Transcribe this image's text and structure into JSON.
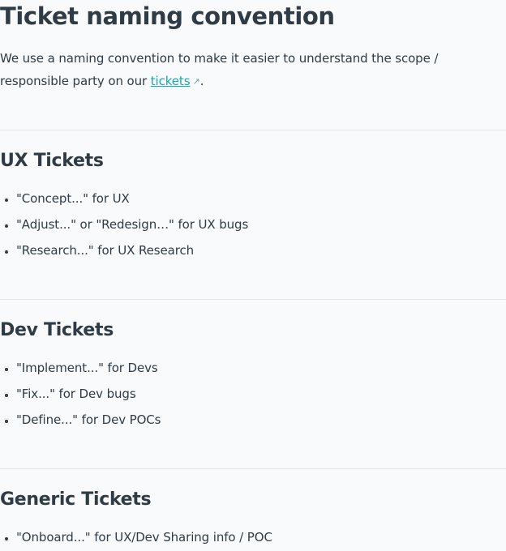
{
  "page": {
    "title": "Ticket naming convention",
    "intro_text": "We use a naming convention to make it easier to understand the scope / responsible party on our",
    "intro_link": "tickets",
    "intro_end": ".",
    "link_icon": "external-link-icon"
  },
  "sections": [
    {
      "heading": "UX Tickets",
      "items": [
        "\"Concept...\" for UX",
        "\"Adjust...\" or \"Redesign…\" for UX bugs",
        "\"Research...\" for UX Research"
      ]
    },
    {
      "heading": "Dev Tickets",
      "items": [
        "\"Implement...\" for Devs",
        "\"Fix...\" for Dev bugs",
        "\"Define...\" for Dev POCs"
      ]
    },
    {
      "heading": "Generic Tickets",
      "items": [
        "\"Onboard...\" for UX/Dev Sharing info / POC"
      ]
    }
  ],
  "colors": {
    "text": "#2f3b45",
    "link": "#18a8b5",
    "background": "#f8fafc",
    "divider": "#e3e7eb"
  }
}
